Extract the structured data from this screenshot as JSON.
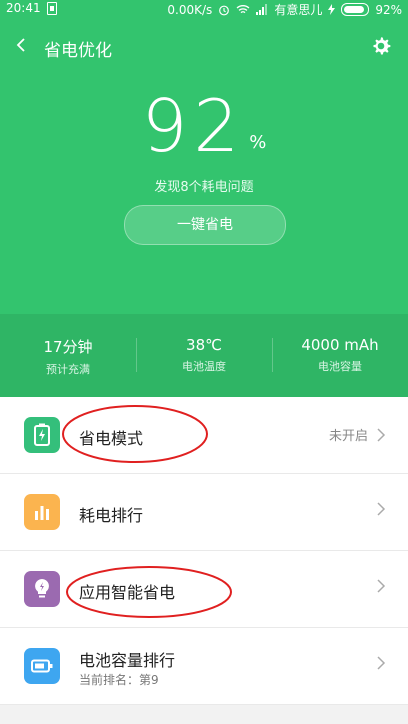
{
  "status_bar": {
    "time": "20:41",
    "network_speed": "0.00K/s",
    "carrier": "有意思儿",
    "battery_text": "92%"
  },
  "header": {
    "title": "省电优化"
  },
  "battery": {
    "percent_value": "92",
    "percent_sign": "%",
    "found_issues": "发现8个耗电问题",
    "one_key_button": "一键省电"
  },
  "stats": [
    {
      "value": "17分钟",
      "label": "预计充满"
    },
    {
      "value": "38℃",
      "label": "电池温度"
    },
    {
      "value": "4000 mAh",
      "label": "电池容量"
    }
  ],
  "list": {
    "items": [
      {
        "label": "省电模式",
        "right_text": "未开启",
        "icon": "battery-bolt-icon",
        "color": "#34bf7b"
      },
      {
        "label": "耗电排行",
        "icon": "bar-chart-icon",
        "color": "#fbb44f"
      },
      {
        "label": "应用智能省电",
        "icon": "lightbulb-bolt-icon",
        "color": "#9b6ab0"
      },
      {
        "label": "电池容量排行",
        "sub": "当前排名：第9",
        "icon": "battery-capacity-icon",
        "color": "#3ea6f0"
      }
    ]
  },
  "colors": {
    "top_bg": "#33c46e",
    "annotation": "#e02020"
  }
}
